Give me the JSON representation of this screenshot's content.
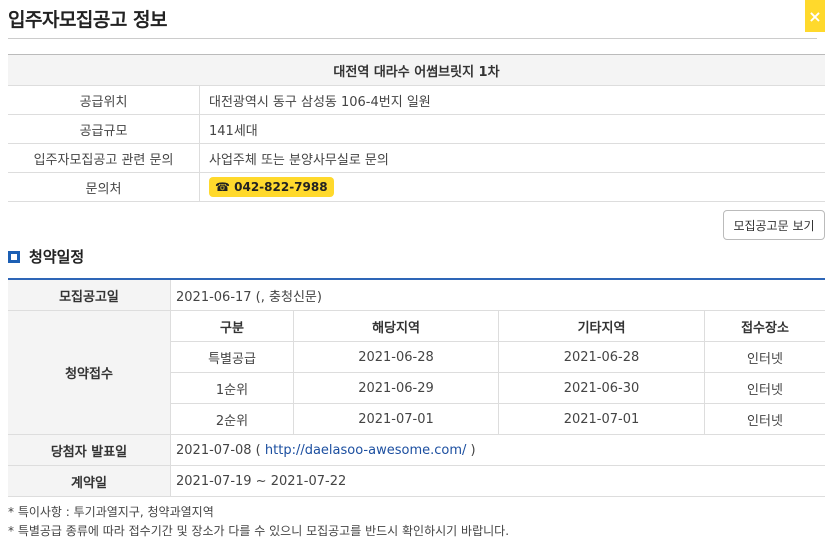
{
  "header": {
    "title": "입주자모집공고 정보",
    "close_icon": "×"
  },
  "info": {
    "complex_name": "대전역 대라수 어썸브릿지 1차",
    "rows": [
      {
        "label": "공급위치",
        "value": "대전광역시 동구 삼성동 106-4번지 일원"
      },
      {
        "label": "공급규모",
        "value": "141세대"
      },
      {
        "label": "입주자모집공고 관련 문의",
        "value": "사업주체 또는 분양사무실로 문의"
      }
    ],
    "contact_label": "문의처",
    "phone": "☎ 042-822-7988"
  },
  "notice_button": "모집공고문 보기",
  "schedule": {
    "section_title": "청약일정",
    "announce_label": "모집공고일",
    "announce_value": "2021-06-17 (, 충청신문)",
    "apply_label": "청약접수",
    "columns": [
      "구분",
      "해당지역",
      "기타지역",
      "접수장소"
    ],
    "rows": [
      [
        "특별공급",
        "2021-06-28",
        "2021-06-28",
        "인터넷"
      ],
      [
        "1순위",
        "2021-06-29",
        "2021-06-30",
        "인터넷"
      ],
      [
        "2순위",
        "2021-07-01",
        "2021-07-01",
        "인터넷"
      ]
    ],
    "winner_label": "당첨자 발표일",
    "winner_date": "2021-07-08 ( ",
    "winner_link": "http://daelasoo-awesome.com/",
    "winner_tail": " )",
    "contract_label": "계약일",
    "contract_value": "2021-07-19 ~ 2021-07-22"
  },
  "footnotes": [
    "* 특이사항 : 투기과열지구, 청약과열지역",
    "* 특별공급 종류에 따라 접수기간 및 장소가 다를 수 있으니 모집공고를 반드시 확인하시기 바랍니다."
  ],
  "colors": {
    "accent_yellow": "#ffd92c",
    "accent_blue": "#2e66b7"
  }
}
